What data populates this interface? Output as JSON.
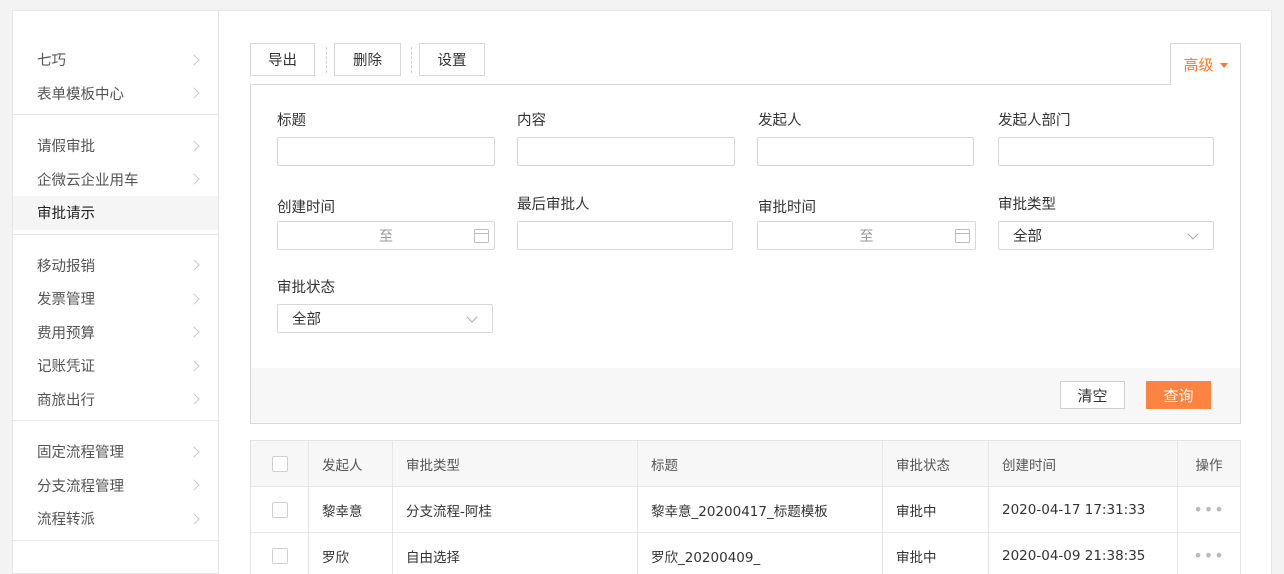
{
  "sidebar": {
    "groups": [
      {
        "items": [
          {
            "label": "七巧"
          },
          {
            "label": "表单模板中心"
          }
        ]
      },
      {
        "items": [
          {
            "label": "请假审批"
          },
          {
            "label": "企微云企业用车"
          },
          {
            "label": "审批请示",
            "active": true
          }
        ]
      },
      {
        "items": [
          {
            "label": "移动报销"
          },
          {
            "label": "发票管理"
          },
          {
            "label": "费用预算"
          },
          {
            "label": "记账凭证"
          },
          {
            "label": "商旅出行"
          }
        ]
      },
      {
        "items": [
          {
            "label": "固定流程管理"
          },
          {
            "label": "分支流程管理"
          },
          {
            "label": "流程转派"
          }
        ]
      }
    ]
  },
  "toolbar": {
    "export": "导出",
    "delete": "删除",
    "settings": "设置",
    "advanced": "高级"
  },
  "filter": {
    "title": {
      "label": "标题",
      "value": ""
    },
    "content": {
      "label": "内容",
      "value": ""
    },
    "initiator": {
      "label": "发起人",
      "value": ""
    },
    "initiator_dept": {
      "label": "发起人部门",
      "value": ""
    },
    "create_time": {
      "label": "创建时间",
      "to": "至"
    },
    "last_approver": {
      "label": "最后审批人",
      "value": ""
    },
    "approve_time": {
      "label": "审批时间",
      "to": "至"
    },
    "approve_type": {
      "label": "审批类型",
      "value": "全部"
    },
    "approve_status": {
      "label": "审批状态",
      "value": "全部"
    },
    "clear": "清空",
    "query": "查询"
  },
  "table": {
    "headers": [
      "发起人",
      "审批类型",
      "标题",
      "审批状态",
      "创建时间",
      "操作"
    ],
    "rows": [
      {
        "initiator": "黎幸意",
        "type": "分支流程-阿桂",
        "title": "黎幸意_20200417_标题模板",
        "status": "审批中",
        "created": "2020-04-17 17:31:33",
        "action": "•••"
      },
      {
        "initiator": "罗欣",
        "type": "自由选择",
        "title": "罗欣_20200409_",
        "status": "审批中",
        "created": "2020-04-09 21:38:35",
        "action": "•••"
      }
    ]
  },
  "colors": {
    "accent": "#ff8442",
    "accent_text": "#ff7a2a"
  }
}
